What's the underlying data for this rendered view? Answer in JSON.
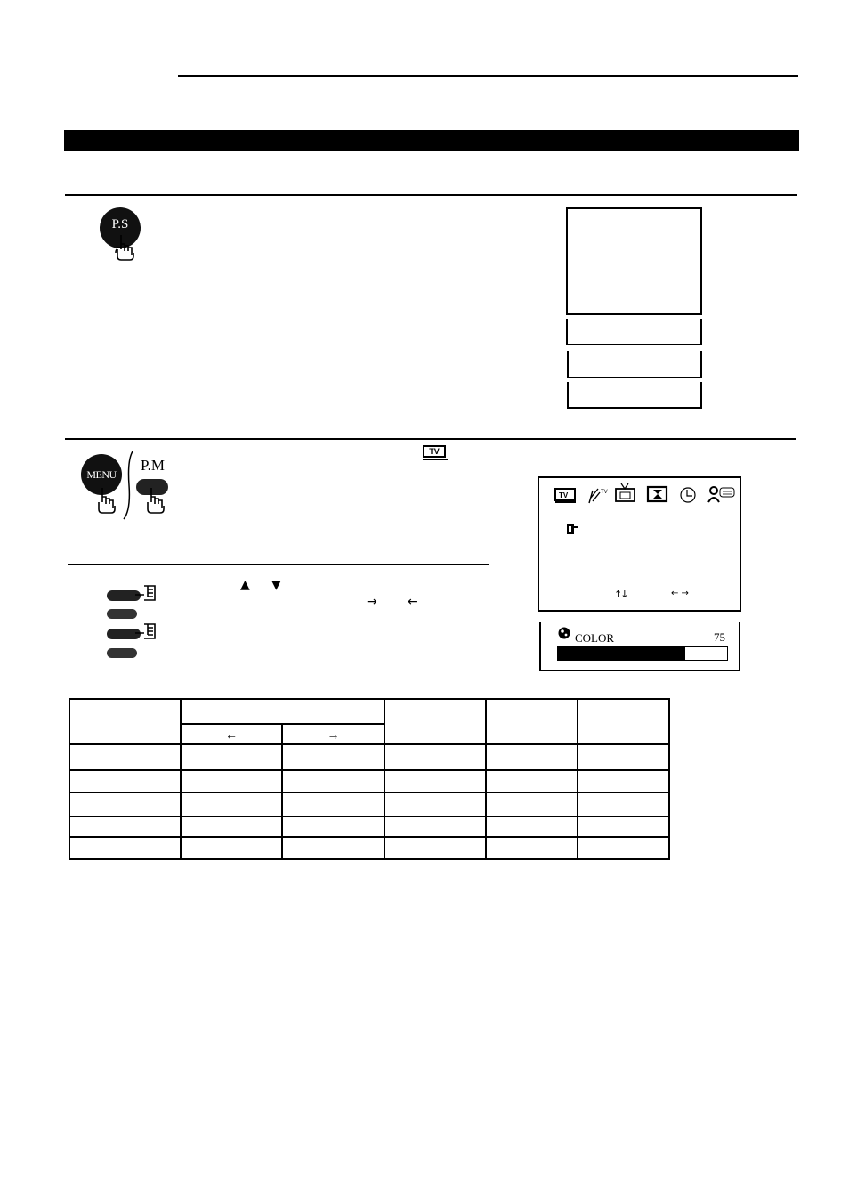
{
  "page": {
    "header_rule": "",
    "section_title": ""
  },
  "step1": {
    "button_label": "P.S"
  },
  "step2": {
    "menu_button_label": "MENU",
    "pm_button_label": "P.M",
    "tv_icon_label": "TV"
  },
  "step3": {
    "up_symbol": "▲",
    "down_symbol": "▼",
    "right_arrow": "→",
    "left_arrow": "←"
  },
  "osd_menu": {
    "icons": [
      "tv-icon",
      "antenna-icon",
      "picture-icon",
      "timer-icon",
      "clock-icon",
      "user-icon"
    ],
    "updown_hint": "↑↓",
    "leftright_hint": "← →"
  },
  "color_bar": {
    "label": "COLOR",
    "value": "75",
    "level_percent": 75
  },
  "table": {
    "subheaders": [
      "←",
      "→"
    ],
    "row_count": 5,
    "col_count": 6
  }
}
